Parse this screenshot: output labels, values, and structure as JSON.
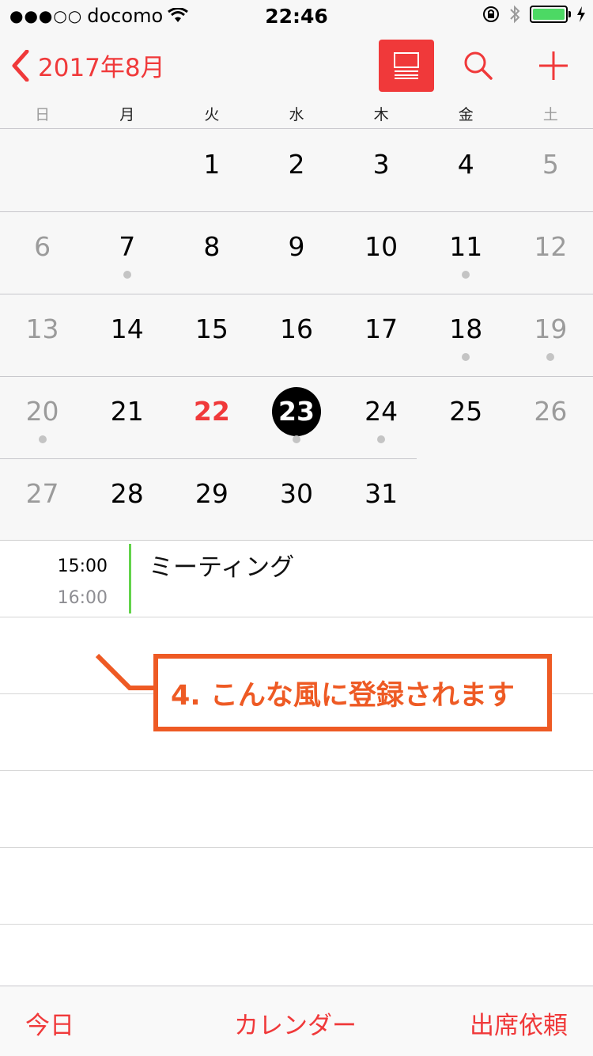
{
  "status": {
    "signal": "●●●○○",
    "carrier": "docomo",
    "time": "22:46"
  },
  "header": {
    "month": "2017年8月"
  },
  "weekdays": [
    "日",
    "月",
    "火",
    "水",
    "木",
    "金",
    "土"
  ],
  "calendar": {
    "weeks": [
      [
        "",
        "",
        "1",
        "2",
        "3",
        "4",
        "5"
      ],
      [
        "6",
        "7",
        "8",
        "9",
        "10",
        "11",
        "12"
      ],
      [
        "13",
        "14",
        "15",
        "16",
        "17",
        "18",
        "19"
      ],
      [
        "20",
        "21",
        "22",
        "23",
        "24",
        "25",
        "26"
      ],
      [
        "27",
        "28",
        "29",
        "30",
        "31",
        "",
        ""
      ]
    ],
    "event_dots": [
      "7",
      "11",
      "18",
      "19",
      "20",
      "23",
      "24"
    ],
    "today": "22",
    "selected": "23"
  },
  "event": {
    "start": "15:00",
    "end": "16:00",
    "title": "ミーティング"
  },
  "annotation": "4. こんな風に登録されます",
  "tabbar": {
    "today": "今日",
    "calendars": "カレンダー",
    "inbox": "出席依頼"
  },
  "colors": {
    "accent": "#f0393a",
    "event_bar": "#63d34b",
    "annotation": "#ee5a24"
  }
}
